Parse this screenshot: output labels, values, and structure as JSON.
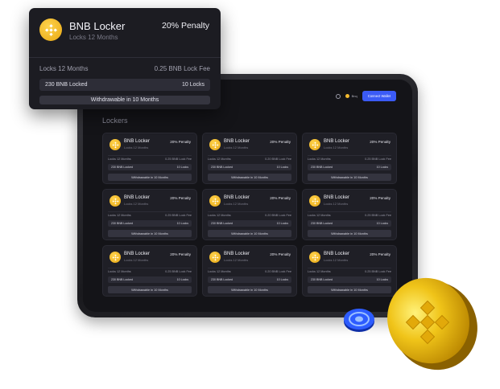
{
  "popup": {
    "name": "BNB Locker",
    "subtitle": "Locks 12 Months",
    "penalty": "20% Penalty",
    "lock_label": "Locks 12 Months",
    "fee": "0.25 BNB Lock Fee",
    "locked": "230 BNB Locked",
    "locks": "10 Locks",
    "withdraw": "Withdrawable in 10 Months"
  },
  "dashboard": {
    "title": "Lockers",
    "network": "Bnq",
    "connect_label": "Connect Wallet"
  },
  "cards": [
    {
      "name": "BNB Locker",
      "subtitle": "Locks 12 Months",
      "penalty": "20% Penalty",
      "lock_label": "Locks 12 Months",
      "fee": "0.25 BNB Lock Fee",
      "locked": "230 BNB Locked",
      "locks": "10 Locks",
      "withdraw": "Withdrawable in 10 Months"
    },
    {
      "name": "BNB Locker",
      "subtitle": "Locks 12 Months",
      "penalty": "20% Penalty",
      "lock_label": "Locks 12 Months",
      "fee": "0.20 BNB Lock Fee",
      "locked": "230 BNB Locked",
      "locks": "10 Locks",
      "withdraw": "Withdrawable in 10 Months"
    },
    {
      "name": "BNB Locker",
      "subtitle": "Locks 12 Months",
      "penalty": "20% Penalty",
      "lock_label": "Locks 12 Months",
      "fee": "0.25 BNB Lock Fee",
      "locked": "230 BNB Locked",
      "locks": "10 Locks",
      "withdraw": "Withdrawable in 10 Months"
    },
    {
      "name": "BNB Locker",
      "subtitle": "Locks 12 Months",
      "penalty": "20% Penalty",
      "lock_label": "Locks 12 Months",
      "fee": "0.25 BNB Lock Fee",
      "locked": "230 BNB Locked",
      "locks": "10 Locks",
      "withdraw": "Withdrawable in 10 Months"
    },
    {
      "name": "BNB Locker",
      "subtitle": "Locks 12 Months",
      "penalty": "20% Penalty",
      "lock_label": "Locks 12 Months",
      "fee": "0.20 BNB Lock Fee",
      "locked": "230 BNB Locked",
      "locks": "10 Locks",
      "withdraw": "Withdrawable in 10 Months"
    },
    {
      "name": "BNB Locker",
      "subtitle": "Locks 12 Months",
      "penalty": "20% Penalty",
      "lock_label": "Locks 12 Months",
      "fee": "0.25 BNB Lock Fee",
      "locked": "230 BNB Locked",
      "locks": "10 Locks",
      "withdraw": "Withdrawable in 10 Months"
    },
    {
      "name": "BNB Locker",
      "subtitle": "Locks 12 Months",
      "penalty": "20% Penalty",
      "lock_label": "Locks 12 Months",
      "fee": "0.25 BNB Lock Fee",
      "locked": "230 BNB Locked",
      "locks": "10 Locks",
      "withdraw": "Withdrawable in 10 Months"
    },
    {
      "name": "BNB Locker",
      "subtitle": "Locks 12 Months",
      "penalty": "20% Penalty",
      "lock_label": "Locks 12 Months",
      "fee": "0.20 BNB Lock Fee",
      "locked": "230 BNB Locked",
      "locks": "10 Locks",
      "withdraw": "Withdrawable in 10 Months"
    },
    {
      "name": "BNB Locker",
      "subtitle": "Locks 12 Months",
      "penalty": "20% Penalty",
      "lock_label": "Locks 12 Months",
      "fee": "0.25 BNB Lock Fee",
      "locked": "230 BNB Locked",
      "locks": "10 Locks",
      "withdraw": "Withdrawable in 10 Months"
    }
  ],
  "icons": {
    "token": "bnb-icon",
    "search": "search-icon",
    "network": "bnb-network-icon",
    "coin": "bnb-coin-icon",
    "blue_coin": "token-coin-icon"
  },
  "colors": {
    "accent": "#3b5bf6",
    "token": "#f3ba2f",
    "surface": "#1f1f26",
    "background": "#141418"
  }
}
